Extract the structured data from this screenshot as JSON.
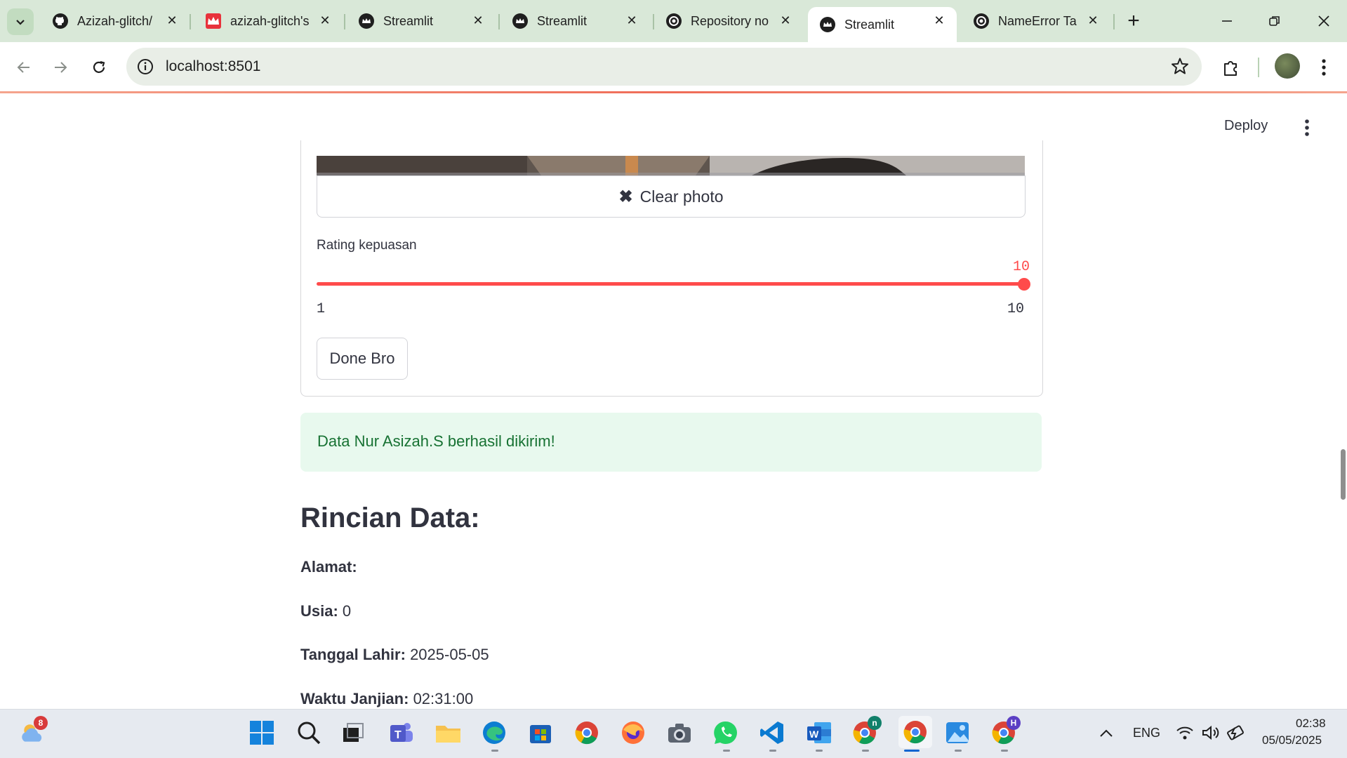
{
  "browser": {
    "tabs": [
      {
        "title": "Azizah-glitch/",
        "favicon": "github-icon"
      },
      {
        "title": "azizah-glitch's",
        "favicon": "streamlit-crown-red-icon"
      },
      {
        "title": "Streamlit",
        "favicon": "streamlit-icon"
      },
      {
        "title": "Streamlit",
        "favicon": "streamlit-icon"
      },
      {
        "title": "Repository no",
        "favicon": "openai-icon"
      },
      {
        "title": "Streamlit",
        "favicon": "streamlit-icon",
        "active": true
      },
      {
        "title": "NameError Ta",
        "favicon": "openai-icon"
      }
    ],
    "url": "localhost:8501"
  },
  "app": {
    "deploy_label": "Deploy",
    "clear_photo_label": "Clear photo",
    "slider": {
      "label": "Rating kepuasan",
      "value": "10",
      "min": "1",
      "max": "10",
      "fraction": 1.0
    },
    "done_button": "Done Bro",
    "success_message": "Data Nur Asizah.S berhasil dikirim!",
    "details_title": "Rincian Data:",
    "details": [
      {
        "label": "Alamat:",
        "value": ""
      },
      {
        "label": "Usia:",
        "value": "0"
      },
      {
        "label": "Tanggal Lahir:",
        "value": "2025-05-05"
      },
      {
        "label": "Waktu Janjian:",
        "value": "02:31:00"
      }
    ]
  },
  "taskbar": {
    "weather_badge": "8",
    "chrome_n_badge": "n",
    "chrome_h_badge": "H",
    "language": "ENG",
    "time": "02:38",
    "date": "05/05/2025"
  },
  "colors": {
    "accent": "#ff4b4b",
    "success_bg": "#e8f9ee",
    "success_text": "#177233"
  }
}
